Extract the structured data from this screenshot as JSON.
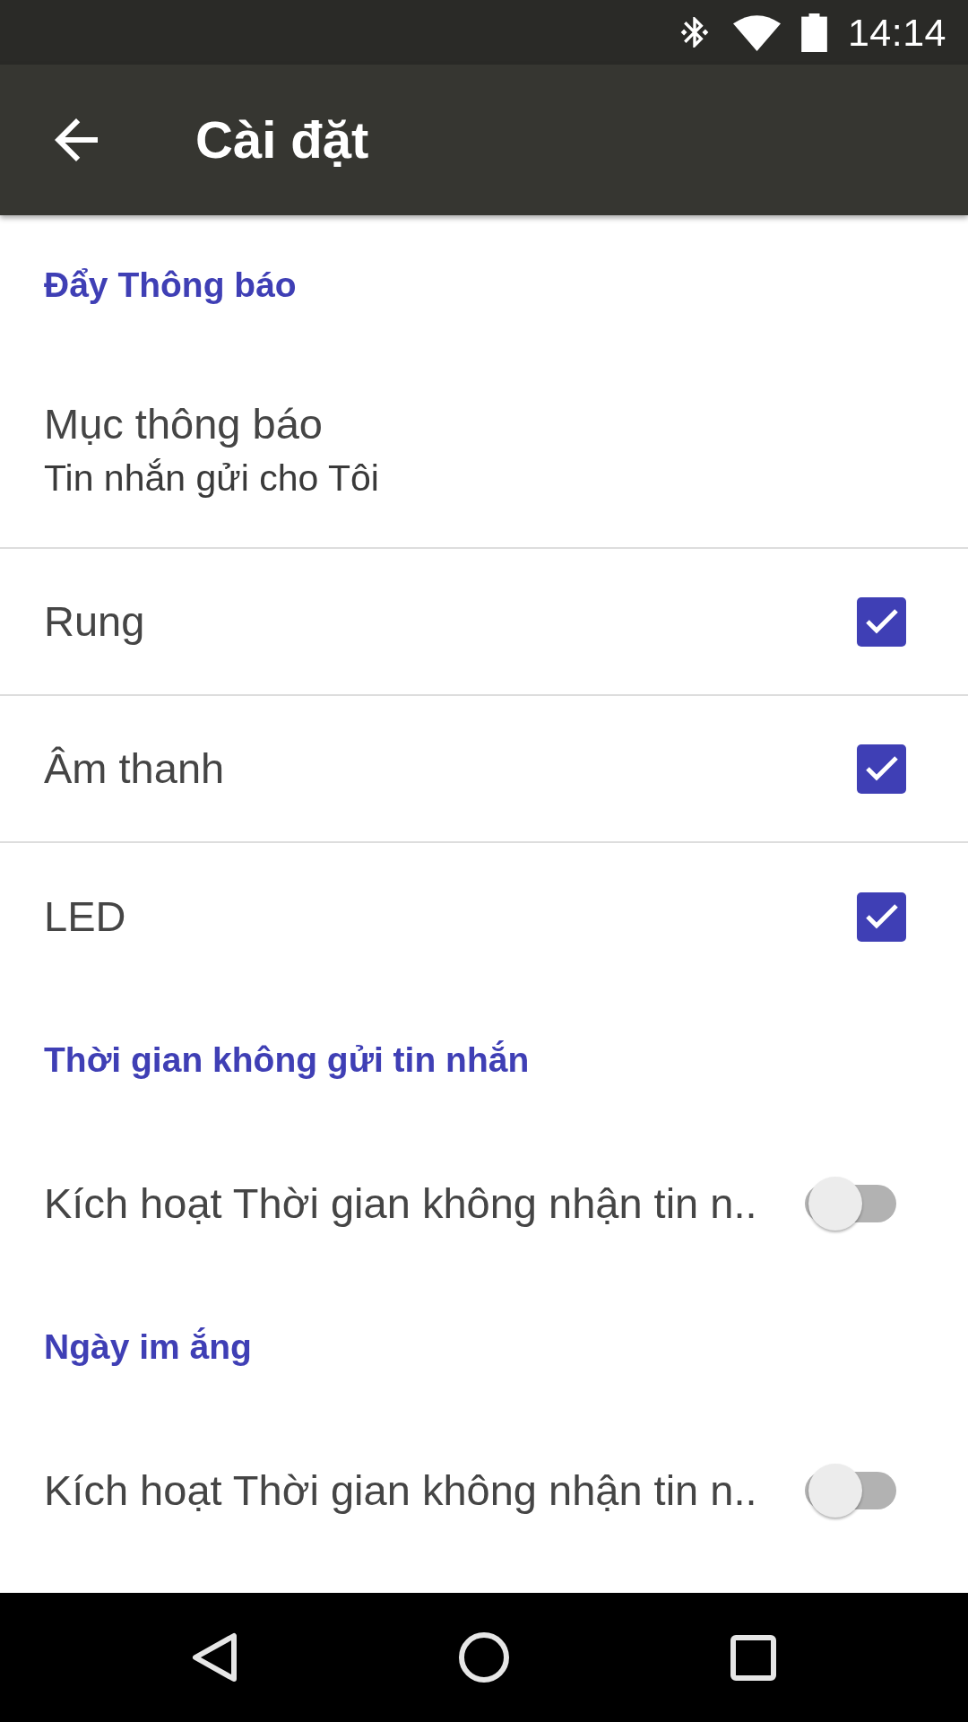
{
  "status_bar": {
    "time": "14:14"
  },
  "app_bar": {
    "title": "Cài đặt"
  },
  "sections": [
    {
      "title": "Đẩy Thông báo",
      "items": [
        {
          "kind": "text",
          "title": "Mục thông báo",
          "summary": "Tin nhắn gửi cho Tôi"
        },
        {
          "kind": "checkbox",
          "title": "Rung",
          "checked": true
        },
        {
          "kind": "checkbox",
          "title": "Âm thanh",
          "checked": true
        },
        {
          "kind": "checkbox",
          "title": "LED",
          "checked": true
        }
      ]
    },
    {
      "title": "Thời gian không gửi tin nhắn",
      "items": [
        {
          "kind": "switch",
          "title": "Kích hoạt Thời gian không nhận tin n..",
          "on": false
        }
      ]
    },
    {
      "title": "Ngày im ắng",
      "items": [
        {
          "kind": "switch",
          "title": "Kích hoạt Thời gian không nhận tin n..",
          "on": false
        }
      ]
    }
  ]
}
